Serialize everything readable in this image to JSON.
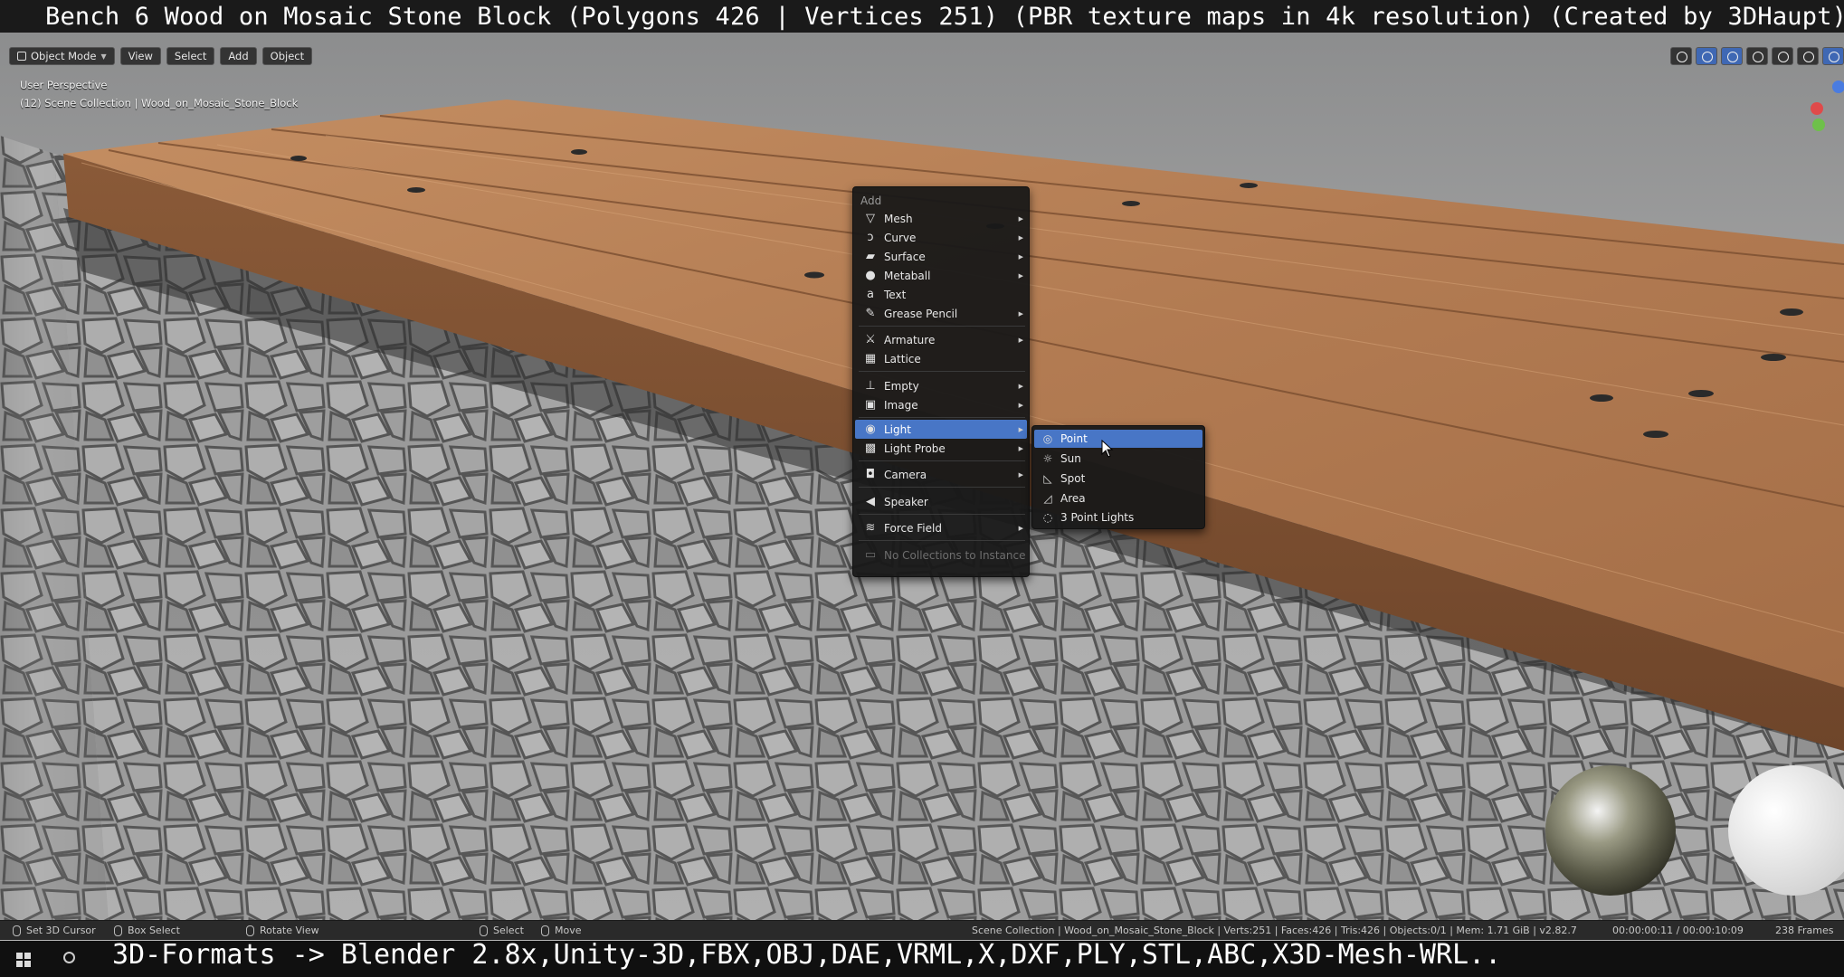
{
  "overlay": {
    "title": "Bench 6 Wood on Mosaic Stone Block (Polygons 426 | Vertices 251) (PBR texture maps in 4k resolution) (Created by 3DHaupt)",
    "caption": "3D-Formats -> Blender 2.8x,Unity-3D,FBX,OBJ,DAE,VRML,X,DXF,PLY,STL,ABC,X3D-Mesh-WRL.."
  },
  "header": {
    "mode": "Object Mode",
    "menus": [
      "View",
      "Select",
      "Add",
      "Object"
    ]
  },
  "viewport": {
    "perspective": "User Perspective",
    "collection": "(12) Scene Collection | Wood_on_Mosaic_Stone_Block"
  },
  "add_menu": {
    "title": "Add",
    "items": [
      {
        "label": "Mesh",
        "icon": "mesh-icon"
      },
      {
        "label": "Curve",
        "icon": "curve-icon"
      },
      {
        "label": "Surface",
        "icon": "surface-icon"
      },
      {
        "label": "Metaball",
        "icon": "metaball-icon"
      },
      {
        "label": "Text",
        "icon": "text-icon"
      },
      {
        "label": "Grease Pencil",
        "icon": "grease-pencil-icon"
      },
      {
        "label": "Armature",
        "icon": "armature-icon"
      },
      {
        "label": "Lattice",
        "icon": "lattice-icon"
      },
      {
        "label": "Empty",
        "icon": "empty-icon"
      },
      {
        "label": "Image",
        "icon": "image-icon"
      },
      {
        "label": "Light",
        "icon": "light-icon"
      },
      {
        "label": "Light Probe",
        "icon": "light-probe-icon"
      },
      {
        "label": "Camera",
        "icon": "camera-icon"
      },
      {
        "label": "Speaker",
        "icon": "speaker-icon"
      },
      {
        "label": "Force Field",
        "icon": "force-field-icon"
      },
      {
        "label": "No Collections to Instance",
        "icon": "collection-icon"
      }
    ]
  },
  "light_submenu": {
    "items": [
      {
        "label": "Point",
        "icon": "point-light-icon"
      },
      {
        "label": "Sun",
        "icon": "sun-light-icon"
      },
      {
        "label": "Spot",
        "icon": "spot-light-icon"
      },
      {
        "label": "Area",
        "icon": "area-light-icon"
      },
      {
        "label": "3 Point Lights",
        "icon": "three-point-lights-icon"
      }
    ]
  },
  "statusbar": {
    "set_cursor": "Set 3D Cursor",
    "box_select": "Box Select",
    "rotate_view": "Rotate View",
    "select": "Select",
    "move": "Move",
    "scene_info": "Scene Collection | Wood_on_Mosaic_Stone_Block | Verts:251 | Faces:426 | Tris:426 | Objects:0/1 | Mem: 1.71 GiB | v2.82.7",
    "time": "00:00:00:11 / 00:00:10:09",
    "frames": "238 Frames"
  }
}
